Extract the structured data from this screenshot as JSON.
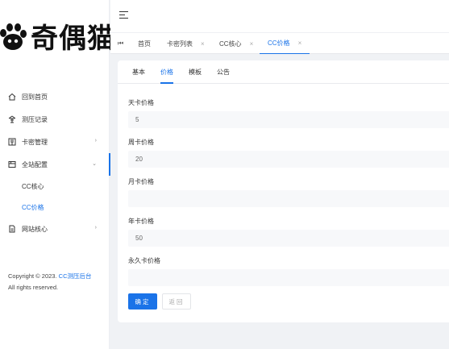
{
  "logo": {
    "text": "奇偶猫"
  },
  "sidebar": {
    "items": [
      {
        "label": "回到首页",
        "icon": "home-icon"
      },
      {
        "label": "测压记录",
        "icon": "record-icon"
      },
      {
        "label": "卡密管理",
        "icon": "card-manage-icon",
        "arrow": "›"
      },
      {
        "label": "全站配置",
        "icon": "config-icon",
        "arrow": "⌄"
      },
      {
        "label": "网站核心",
        "icon": "doc-icon",
        "arrow": "›"
      }
    ],
    "submenu": [
      {
        "label": "CC核心"
      },
      {
        "label": "CC价格"
      }
    ]
  },
  "copyright": {
    "prefix": "Copyright © 2023. ",
    "link": "CC测压后台",
    "line2": "All rights reserved."
  },
  "tabs": {
    "first_icon": "⏮",
    "items": [
      {
        "label": "首页",
        "close": ""
      },
      {
        "label": "卡密列表",
        "close": "×"
      },
      {
        "label": "CC核心",
        "close": "×"
      },
      {
        "label": "CC价格",
        "close": "×"
      }
    ]
  },
  "subtabs": [
    "基本",
    "价格",
    "模板",
    "公告"
  ],
  "form": {
    "fields": [
      {
        "label": "天卡价格",
        "value": "5"
      },
      {
        "label": "周卡价格",
        "value": "20"
      },
      {
        "label": "月卡价格",
        "value": ""
      },
      {
        "label": "年卡价格",
        "value": "50"
      },
      {
        "label": "永久卡价格",
        "value": ""
      }
    ],
    "confirm": "确定",
    "back": "返回"
  },
  "colors": {
    "accent": "#1a73e8",
    "background": "#f0f2f5"
  }
}
